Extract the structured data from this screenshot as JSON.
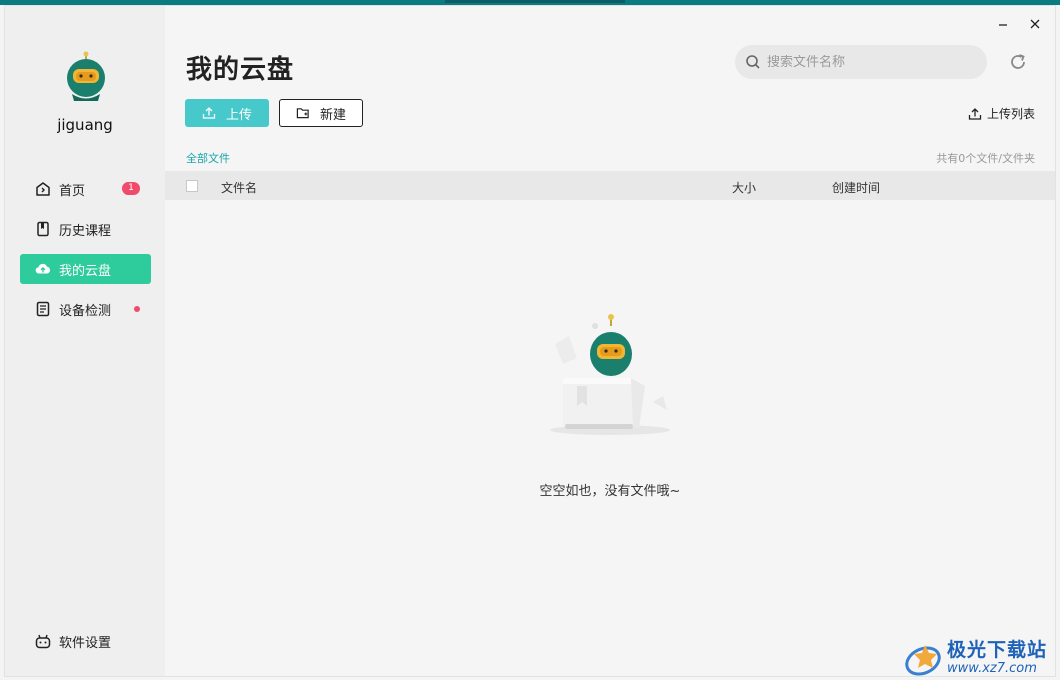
{
  "user": {
    "name": "jiguang"
  },
  "sidebar": {
    "items": [
      {
        "label": "首页",
        "badge": "1"
      },
      {
        "label": "历史课程"
      },
      {
        "label": "我的云盘"
      },
      {
        "label": "设备检测"
      }
    ],
    "settings_label": "软件设置"
  },
  "main": {
    "title": "我的云盘",
    "search_placeholder": "搜索文件名称",
    "upload_label": "上传",
    "new_label": "新建",
    "upload_list_label": "上传列表",
    "breadcrumb": "全部文件",
    "count_text": "共有0个文件/文件夹",
    "table_headers": {
      "name": "文件名",
      "size": "大小",
      "created": "创建时间"
    },
    "empty_text": "空空如也，没有文件哦~"
  },
  "watermark": {
    "title": "极光下载站",
    "url": "www.xz7.com"
  },
  "colors": {
    "accent": "#2ecb9c",
    "upload_button": "#47c8cb",
    "badge": "#f04b6a",
    "link": "#1aa5a8",
    "titlebar": "#0b7b82"
  }
}
